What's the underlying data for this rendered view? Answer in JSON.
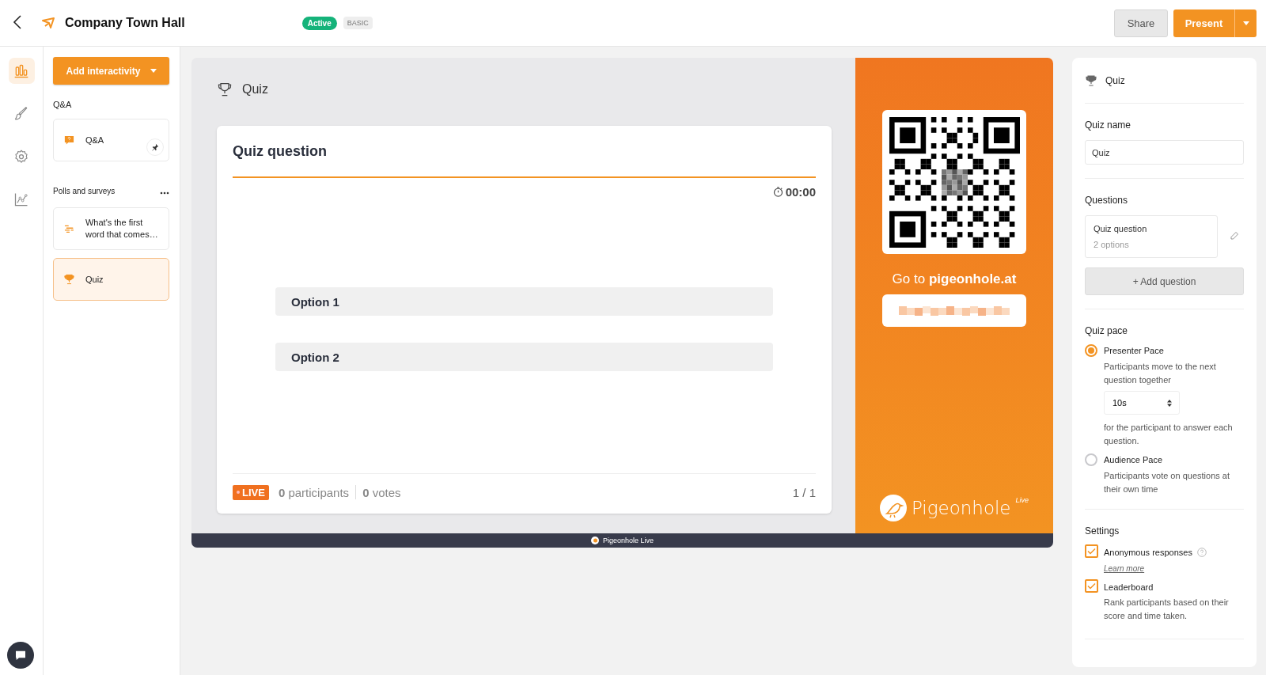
{
  "header": {
    "title": "Company Town Hall",
    "status_badge": "Active",
    "plan_badge": "BASIC",
    "share_button": "Share",
    "present_button": "Present"
  },
  "rail": [
    {
      "kind": "chart",
      "selected": true
    },
    {
      "kind": "brush",
      "selected": false
    },
    {
      "kind": "gear",
      "selected": false
    },
    {
      "kind": "analytics",
      "selected": false
    }
  ],
  "sidebar": {
    "add_button": "Add interactivity",
    "sections": [
      {
        "title": "Q&A",
        "menu": false,
        "items": [
          {
            "kind": "qa",
            "label": "Q&A",
            "selected": false,
            "pinned": true
          }
        ]
      },
      {
        "title": "Polls and surveys",
        "menu": true,
        "items": [
          {
            "kind": "wordcloud",
            "label": "What's the first word that comes…",
            "selected": false,
            "pinned": false
          },
          {
            "kind": "quiz",
            "label": "Quiz",
            "selected": true,
            "pinned": false
          }
        ]
      }
    ]
  },
  "slide": {
    "header": "Quiz",
    "question": "Quiz question",
    "timer": "00:00",
    "options": [
      "Option 1",
      "Option 2"
    ],
    "footer": {
      "live_badge": "LIVE",
      "participants": "**0** participants",
      "votes": "**0** votes",
      "page": "1 / 1"
    },
    "side": {
      "prompt": "Go to **pigeonhole.at**",
      "logo_text": "Pigeonhole",
      "logo_super": "Live"
    },
    "bottom_bar": "Pigeonhole Live"
  },
  "settings_panel": {
    "header": "Quiz",
    "name_label": "Quiz name",
    "name_value": "Quiz",
    "questions_title": "Questions",
    "questions": [
      {
        "title": "Quiz question",
        "subtitle": "2 options"
      }
    ],
    "add_question": "+ Add question",
    "pace_title": "Quiz pace",
    "pace_options": [
      {
        "label": "Presenter Pace",
        "description": "Participants move to the next question together",
        "timer_value": "10s",
        "after": "for the participant to answer each question.",
        "selected": true
      },
      {
        "label": "Audience Pace",
        "description": "Participants vote on questions at their own time",
        "selected": false
      }
    ],
    "settings_title": "Settings",
    "settings": [
      {
        "label": "Anonymous responses",
        "checked": true,
        "help": true,
        "link": "Learn more"
      },
      {
        "label": "Leaderboard",
        "checked": true,
        "help": false,
        "description": "Rank participants based on their score and time taken."
      }
    ]
  }
}
